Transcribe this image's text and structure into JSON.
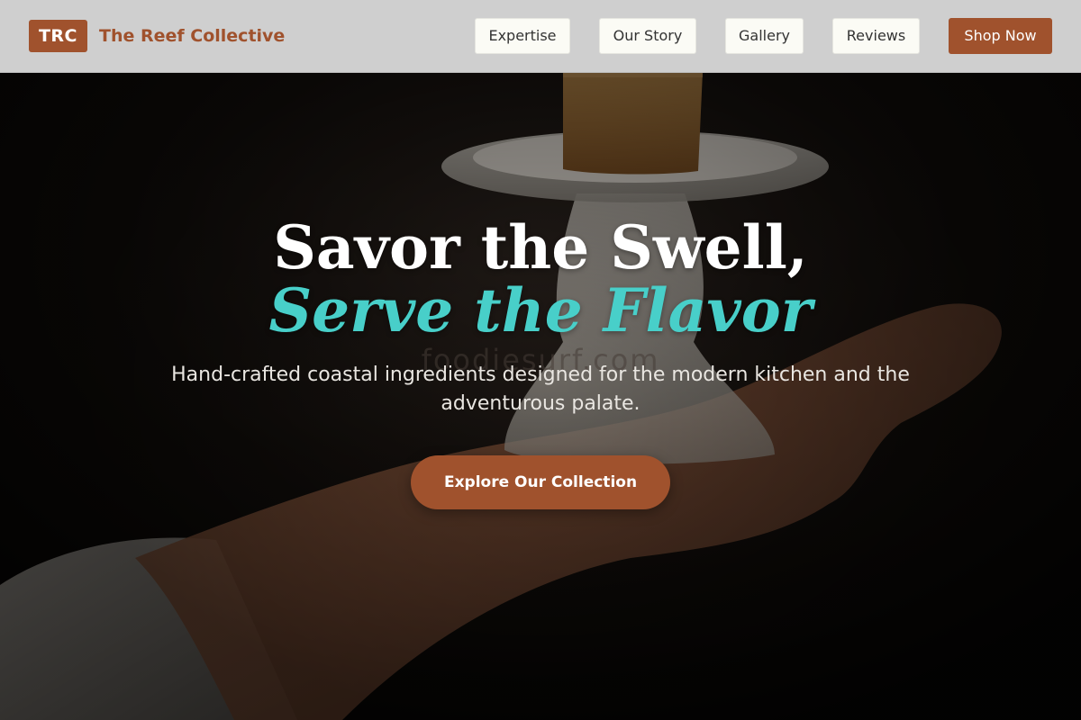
{
  "brand": {
    "badge": "TRC",
    "name": "The Reef Collective"
  },
  "nav": {
    "items": [
      {
        "label": "Expertise"
      },
      {
        "label": "Our Story"
      },
      {
        "label": "Gallery"
      },
      {
        "label": "Reviews"
      }
    ],
    "cta_label": "Shop Now"
  },
  "hero": {
    "title_line1": "Savor the Swell,",
    "title_line2": "Serve the Flavor",
    "watermark": "foodiesurf.com",
    "subtitle": "Hand-crafted coastal ingredients designed for the modern kitchen and the adventurous palate.",
    "cta_label": "Explore Our Collection"
  },
  "colors": {
    "accent_brown": "#a0522d",
    "accent_teal": "#48cfc9",
    "header_bg": "#d6d6d6",
    "nav_button_bg": "#fbfbf5",
    "hero_bg": "#0b0907"
  }
}
